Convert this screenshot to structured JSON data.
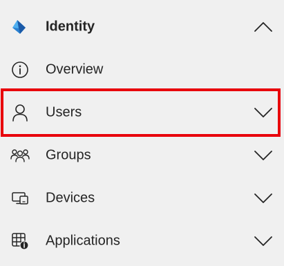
{
  "nav": {
    "header": {
      "label": "Identity",
      "icon": "identity-diamond-icon",
      "chevron": "chevron-up-icon"
    },
    "items": [
      {
        "label": "Overview",
        "icon": "info-icon"
      },
      {
        "label": "Users",
        "icon": "user-icon",
        "chevron": "chevron-down-icon",
        "highlighted": true
      },
      {
        "label": "Groups",
        "icon": "groups-icon",
        "chevron": "chevron-down-icon"
      },
      {
        "label": "Devices",
        "icon": "devices-icon",
        "chevron": "chevron-down-icon"
      },
      {
        "label": "Applications",
        "icon": "applications-icon",
        "chevron": "chevron-down-icon"
      }
    ]
  },
  "colors": {
    "background": "#f0f0f0",
    "text": "#242424",
    "highlight_border": "#e8000b",
    "identity_dark_blue": "#1a5aa8",
    "identity_light_blue": "#50b0f0"
  }
}
